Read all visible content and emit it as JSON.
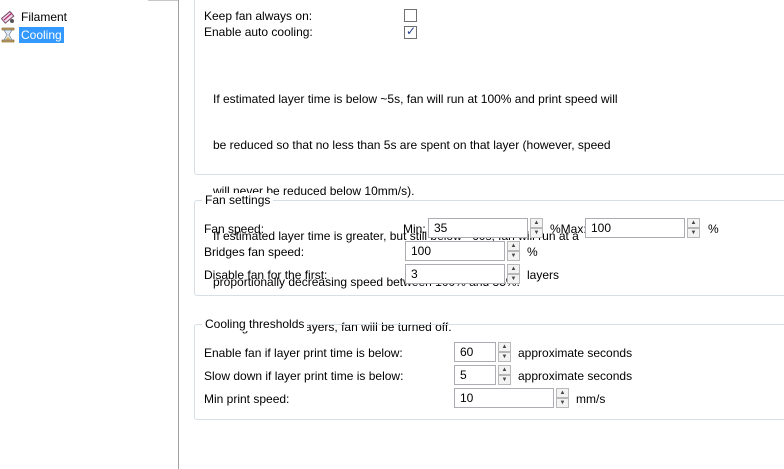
{
  "tree": {
    "items": [
      {
        "label": "Filament",
        "icon": "filament-spool-icon",
        "selected": false
      },
      {
        "label": "Cooling",
        "icon": "hourglass-icon",
        "selected": true
      }
    ]
  },
  "cooling": {
    "keep_fan_label": "Keep fan always on:",
    "keep_fan_checked": false,
    "auto_cooling_label": "Enable auto cooling:",
    "auto_cooling_checked": true,
    "description": [
      "If estimated layer time is below ~5s, fan will run at 100% and print speed will",
      "be reduced so that no less than 5s are spent on that layer (however, speed",
      "will never be reduced below 10mm/s).",
      "If estimated layer time is greater, but still below ~60s, fan will run at a",
      "proportionally decreasing speed between 100% and 35%.",
      "During the other layers, fan will be turned off."
    ]
  },
  "fan_settings": {
    "title": "Fan settings",
    "fan_speed_label": "Fan speed:",
    "min_label": "Min:",
    "min_value": "35",
    "max_label": "%Max:",
    "max_value": "100",
    "max_unit": "%",
    "bridges_label": "Bridges fan speed:",
    "bridges_value": "100",
    "bridges_unit": "%",
    "disable_label": "Disable fan for the first:",
    "disable_value": "3",
    "disable_unit": "layers"
  },
  "thresholds": {
    "title": "Cooling thresholds",
    "enable_fan_label": "Enable fan if layer print time is below:",
    "enable_fan_value": "60",
    "enable_fan_unit": "approximate seconds",
    "slow_down_label": "Slow down if layer print time is below:",
    "slow_down_value": "5",
    "slow_down_unit": "approximate seconds",
    "min_speed_label": "Min print speed:",
    "min_speed_value": "10",
    "min_speed_unit": "mm/s"
  },
  "spin_glyphs": {
    "up": "▲",
    "down": "▼"
  }
}
